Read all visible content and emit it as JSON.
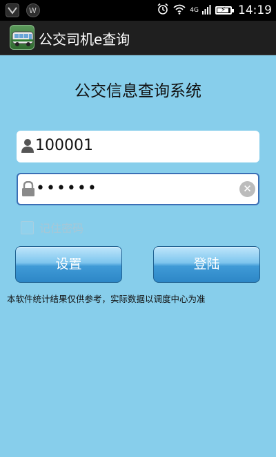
{
  "status_bar": {
    "icons": [
      "notification-app-icon",
      "notification-app-icon-2",
      "alarm-icon",
      "wifi-icon",
      "signal-icon",
      "battery-icon"
    ],
    "network": "4G",
    "battery_level": 0.9,
    "time": "14:19"
  },
  "app": {
    "title": "公交司机e查询",
    "icon": "bus-icon"
  },
  "login": {
    "heading": "公交信息查询系统",
    "username_value": "100001",
    "password_value": "••••••",
    "remember_label": "记住密码",
    "remember_checked": false,
    "settings_label": "设置",
    "login_label": "登陆",
    "disclaimer": "本软件统计结果仅供参考，实际数据以调度中心为准"
  },
  "colors": {
    "background": "#87ceeb",
    "button": "#3f9ad6",
    "focus_border": "#3b6fb5"
  }
}
